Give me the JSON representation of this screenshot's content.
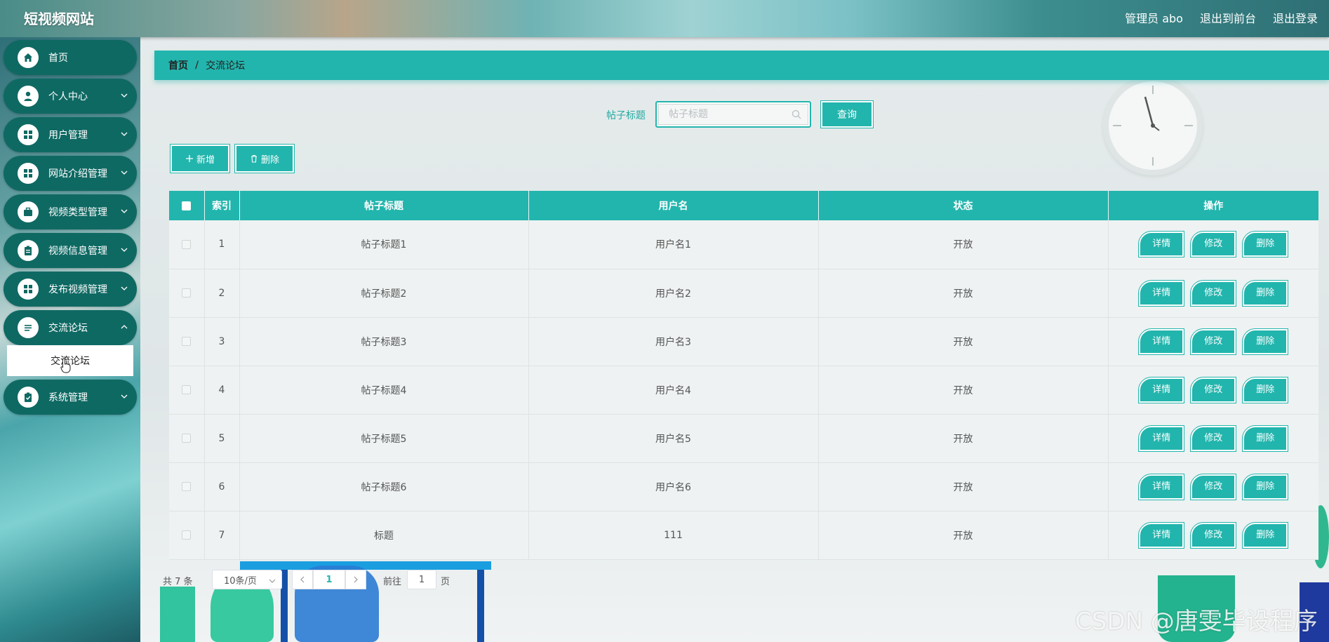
{
  "header": {
    "site_title": "短视频网站",
    "links": [
      "管理员 abo",
      "退出到前台",
      "退出登录"
    ]
  },
  "sidebar": {
    "items": [
      {
        "label": "首页",
        "icon": "home-icon",
        "has_children": false
      },
      {
        "label": "个人中心",
        "icon": "user-icon",
        "has_children": true
      },
      {
        "label": "用户管理",
        "icon": "grid-icon",
        "has_children": true
      },
      {
        "label": "网站介绍管理",
        "icon": "grid-icon",
        "has_children": true
      },
      {
        "label": "视频类型管理",
        "icon": "briefcase-icon",
        "has_children": true
      },
      {
        "label": "视频信息管理",
        "icon": "clipboard-icon",
        "has_children": true
      },
      {
        "label": "发布视频管理",
        "icon": "grid-icon",
        "has_children": true
      },
      {
        "label": "交流论坛",
        "icon": "list-icon",
        "has_children": true,
        "expanded": true
      },
      {
        "label": "系统管理",
        "icon": "clipboard-check-icon",
        "has_children": true
      }
    ],
    "submenu": {
      "label": "交流论坛"
    }
  },
  "breadcrumb": {
    "home": "首页",
    "separator": "/",
    "current": "交流论坛"
  },
  "search": {
    "label": "帖子标题",
    "placeholder": "帖子标题",
    "value": "",
    "button_label": "查询"
  },
  "actions": {
    "add_label": "新增",
    "delete_label": "删除"
  },
  "table": {
    "columns": [
      "索引",
      "帖子标题",
      "用户名",
      "状态",
      "操作"
    ],
    "rows": [
      {
        "index": "1",
        "title": "帖子标题1",
        "username": "用户名1",
        "status": "开放"
      },
      {
        "index": "2",
        "title": "帖子标题2",
        "username": "用户名2",
        "status": "开放"
      },
      {
        "index": "3",
        "title": "帖子标题3",
        "username": "用户名3",
        "status": "开放"
      },
      {
        "index": "4",
        "title": "帖子标题4",
        "username": "用户名4",
        "status": "开放"
      },
      {
        "index": "5",
        "title": "帖子标题5",
        "username": "用户名5",
        "status": "开放"
      },
      {
        "index": "6",
        "title": "帖子标题6",
        "username": "用户名6",
        "status": "开放"
      },
      {
        "index": "7",
        "title": "标题",
        "username": "111",
        "status": "开放"
      }
    ],
    "row_actions": [
      "详情",
      "修改",
      "删除"
    ]
  },
  "pagination": {
    "total": "共 7 条",
    "page_size": "10条/页",
    "current_page": "1",
    "goto_label": "前往",
    "goto_value": "1",
    "goto_suffix": "页"
  },
  "watermark": "CSDN @唐雯毕设程序",
  "colors": {
    "accent": "#22b5ad",
    "menu_bg": "#0f6963"
  }
}
